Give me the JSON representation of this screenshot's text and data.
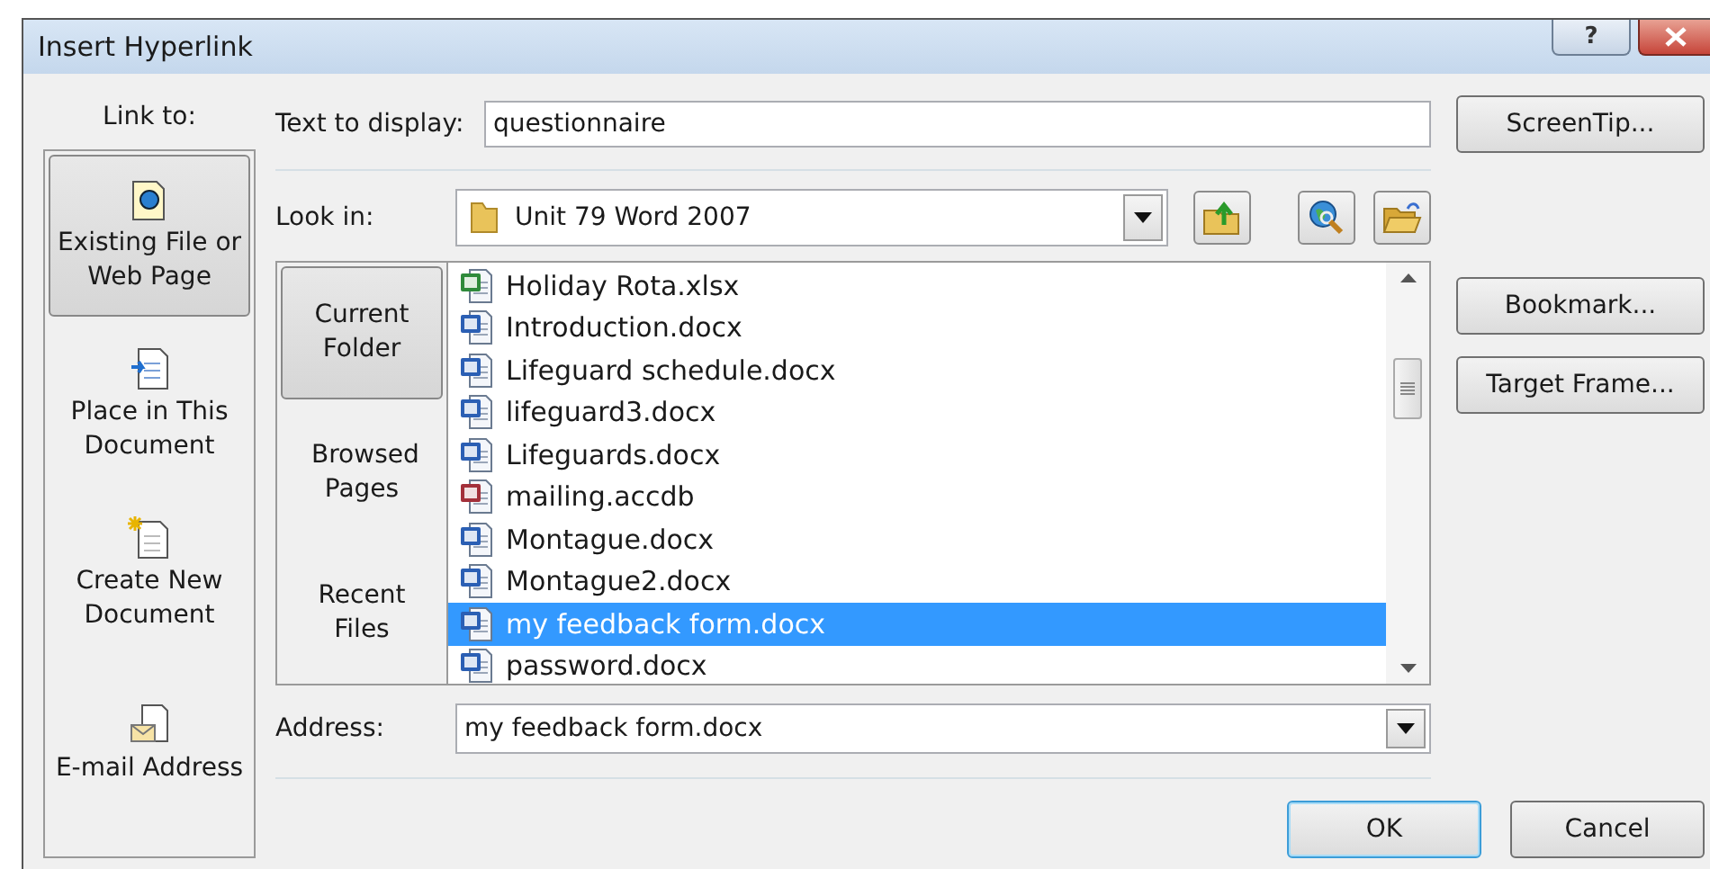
{
  "window": {
    "title": "Insert Hyperlink",
    "buttons": [
      "?"
    ]
  },
  "link_to": {
    "label": "Link to:",
    "items": [
      {
        "label": "Existing File or Web Page",
        "kind": "file",
        "selected": true
      },
      {
        "label": "Place in This Document",
        "kind": "place",
        "selected": false
      },
      {
        "label": "Create New Document",
        "kind": "new",
        "selected": false
      },
      {
        "label": "E-mail Address",
        "kind": "email",
        "selected": false
      }
    ]
  },
  "text_to_display": {
    "label": "Text to display:",
    "value": "questionnaire"
  },
  "screentip_button": "ScreenTip...",
  "look_in": {
    "label": "Look in:",
    "value": "Unit 79 Word 2007"
  },
  "nav": [
    {
      "label": "Current Folder",
      "selected": true
    },
    {
      "label": "Browsed Pages",
      "selected": false
    },
    {
      "label": "Recent Files",
      "selected": false
    }
  ],
  "files": [
    {
      "name": "Holiday Rota.xlsx",
      "kind": "excel",
      "selected": false
    },
    {
      "name": "Introduction.docx",
      "kind": "word",
      "selected": false
    },
    {
      "name": "Lifeguard schedule.docx",
      "kind": "word",
      "selected": false
    },
    {
      "name": "lifeguard3.docx",
      "kind": "word",
      "selected": false
    },
    {
      "name": "Lifeguards.docx",
      "kind": "word",
      "selected": false
    },
    {
      "name": "mailing.accdb",
      "kind": "access",
      "selected": false
    },
    {
      "name": "Montague.docx",
      "kind": "word",
      "selected": false
    },
    {
      "name": "Montague2.docx",
      "kind": "word",
      "selected": false
    },
    {
      "name": "my feedback form.docx",
      "kind": "word",
      "selected": true
    },
    {
      "name": "password.docx",
      "kind": "word",
      "selected": false
    }
  ],
  "side_buttons": [
    "Bookmark...",
    "Target Frame..."
  ],
  "address": {
    "label": "Address:",
    "value": "my feedback form.docx"
  },
  "footer_buttons": [
    {
      "label": "OK",
      "default": true
    },
    {
      "label": "Cancel",
      "default": false
    }
  ]
}
